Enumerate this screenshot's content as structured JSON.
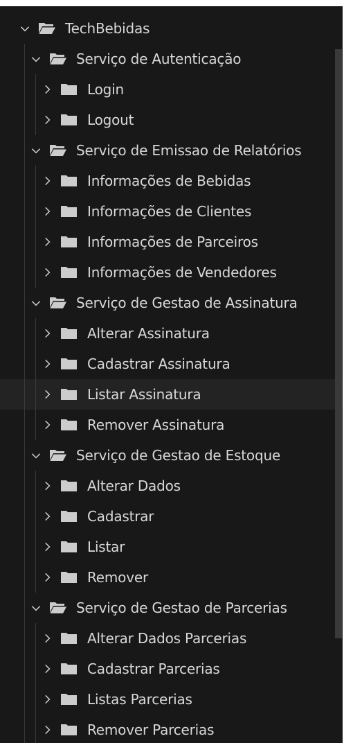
{
  "tree": {
    "root": {
      "label": "TechBebidas",
      "expanded": true
    },
    "groups": [
      {
        "label": "Serviço de Autenticação",
        "items": [
          "Login",
          "Logout"
        ]
      },
      {
        "label": "Serviço de Emissao de Relatórios",
        "items": [
          "Informações de Bebidas",
          "Informações de Clientes",
          "Informações de Parceiros",
          "Informações de Vendedores"
        ]
      },
      {
        "label": "Serviço de Gestao de Assinatura",
        "items": [
          "Alterar Assinatura",
          "Cadastrar Assinatura",
          "Listar Assinatura",
          "Remover Assinatura"
        ]
      },
      {
        "label": "Serviço de Gestao de Estoque",
        "items": [
          "Alterar Dados",
          "Cadastrar",
          "Listar",
          "Remover"
        ]
      },
      {
        "label": "Serviço de Gestao de Parcerias",
        "items": [
          "Alterar Dados Parcerias",
          "Cadastrar Parcerias",
          "Listas Parcerias",
          "Remover Parcerias"
        ]
      }
    ],
    "selected_item": "Listar Assinatura"
  },
  "colors": {
    "background": "#181818",
    "text": "#d8d8d8",
    "icon": "#cccccc",
    "selected_row": "#232323",
    "indent_guide": "#3a3a3a"
  },
  "icons": {
    "expanded": "chevron-down-icon",
    "collapsed": "chevron-right-icon",
    "open_folder": "folder-open-icon",
    "closed_folder": "folder-icon"
  }
}
